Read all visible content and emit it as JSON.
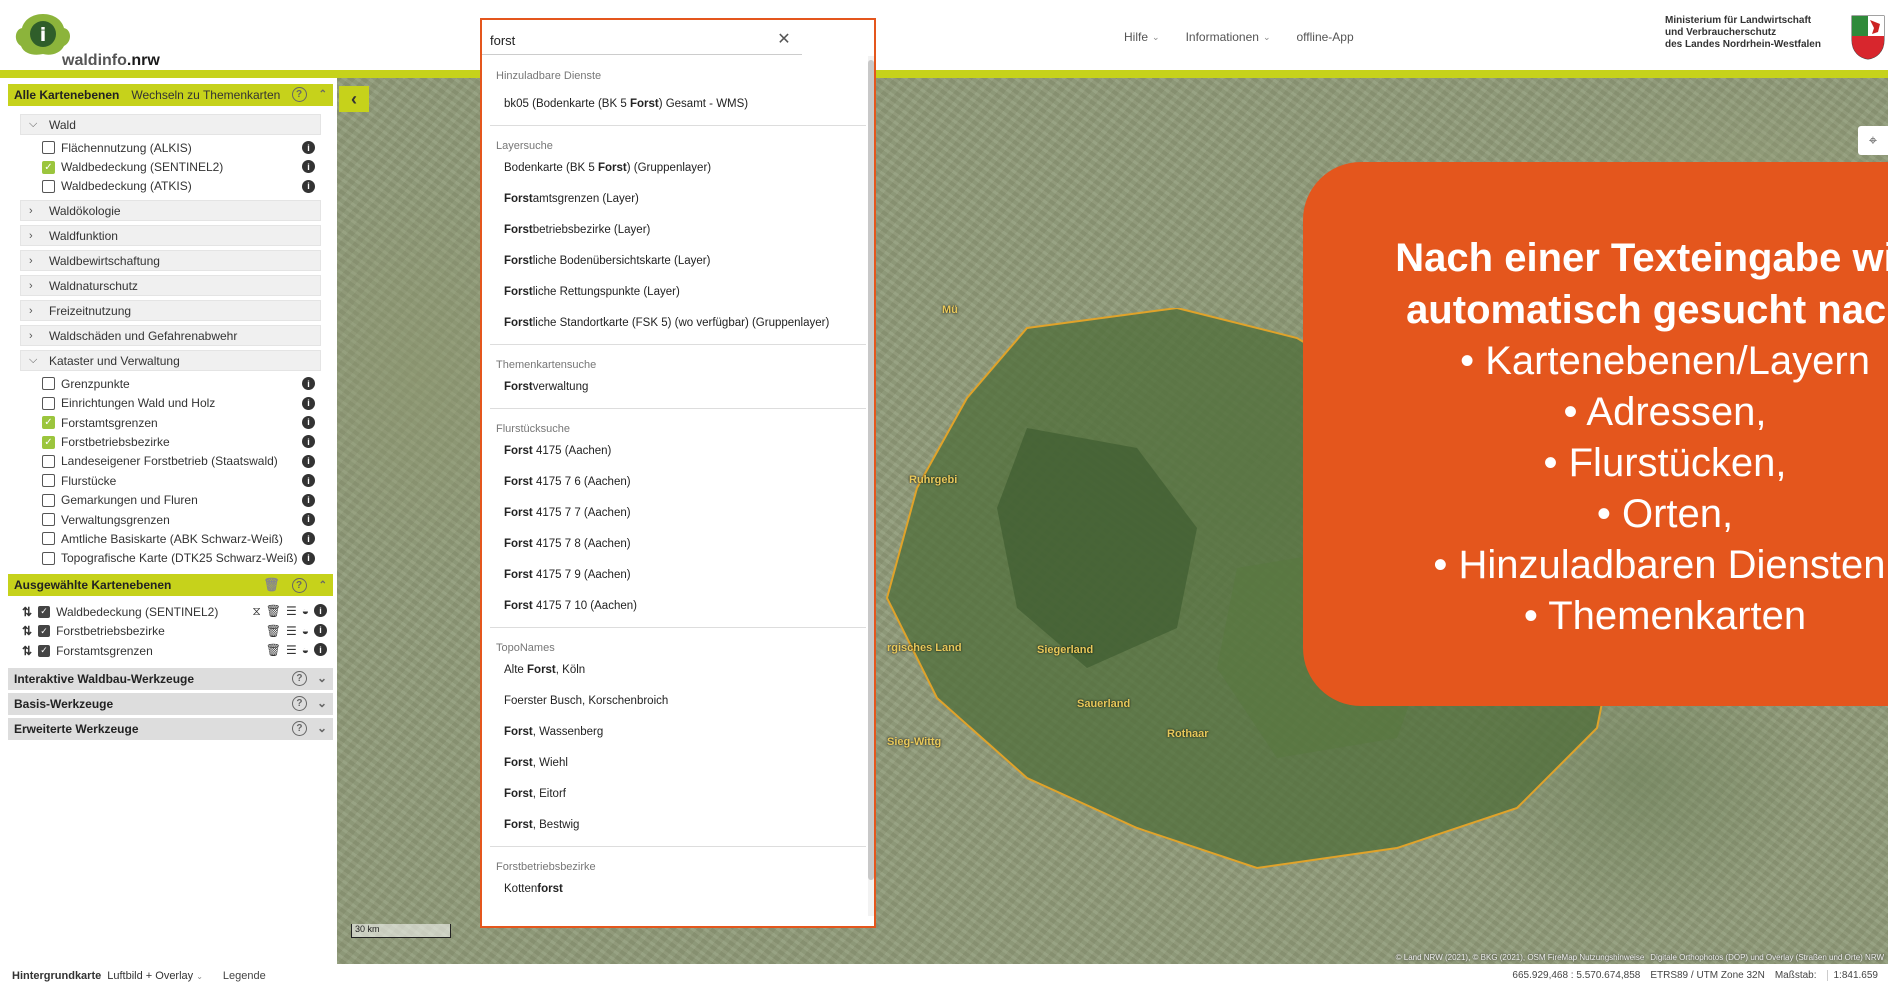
{
  "header": {
    "logo_text_a": "waldinfo",
    "logo_text_b": ".nrw",
    "nav": [
      {
        "label": "Hilfe",
        "has_menu": true
      },
      {
        "label": "Informationen",
        "has_menu": true
      },
      {
        "label": "offline-App",
        "has_menu": false
      }
    ],
    "ministry": [
      "Ministerium für Landwirtschaft",
      "und Verbraucherschutz",
      "des Landes Nordrhein-Westfalen"
    ]
  },
  "sidebar": {
    "layers_header": "Alle Kartenebenen",
    "switch_label": "Wechseln zu Themenkarten",
    "groups": [
      {
        "label": "Wald",
        "expanded": true,
        "layers": [
          {
            "label": "Flächennutzung (ALKIS)",
            "checked": false
          },
          {
            "label": "Waldbedeckung (SENTINEL2)",
            "checked": true
          },
          {
            "label": "Waldbedeckung (ATKIS)",
            "checked": false
          }
        ]
      },
      {
        "label": "Waldökologie",
        "expanded": false
      },
      {
        "label": "Waldfunktion",
        "expanded": false
      },
      {
        "label": "Waldbewirtschaftung",
        "expanded": false
      },
      {
        "label": "Waldnaturschutz",
        "expanded": false
      },
      {
        "label": "Freizeitnutzung",
        "expanded": false
      },
      {
        "label": "Waldschäden und Gefahrenabwehr",
        "expanded": false
      },
      {
        "label": "Kataster und Verwaltung",
        "expanded": true,
        "layers": [
          {
            "label": "Grenzpunkte",
            "checked": false
          },
          {
            "label": "Einrichtungen Wald und Holz",
            "checked": false
          },
          {
            "label": "Forstamtsgrenzen",
            "checked": true
          },
          {
            "label": "Forstbetriebsbezirke",
            "checked": true
          },
          {
            "label": "Landeseigener Forstbetrieb (Staatswald)",
            "checked": false
          },
          {
            "label": "Flurstücke",
            "checked": false
          },
          {
            "label": "Gemarkungen und Fluren",
            "checked": false
          },
          {
            "label": "Verwaltungsgrenzen",
            "checked": false
          },
          {
            "label": "Amtliche Basiskarte (ABK Schwarz-Weiß)",
            "checked": false
          },
          {
            "label": "Topografische Karte (DTK25 Schwarz-Weiß)",
            "checked": false
          }
        ]
      }
    ],
    "selected_header": "Ausgewählte Kartenebenen",
    "selected": [
      {
        "label": "Waldbedeckung (SENTINEL2)"
      },
      {
        "label": "Forstbetriebsbezirke"
      },
      {
        "label": "Forstamtsgrenzen"
      }
    ],
    "tools": [
      {
        "label": "Interaktive Waldbau-Werkzeuge"
      },
      {
        "label": "Basis-Werkzeuge"
      },
      {
        "label": "Erweiterte Werkzeuge"
      }
    ]
  },
  "search": {
    "value": "forst",
    "clear_icon": "close-icon",
    "results": [
      {
        "category": "Hinzuladbare Dienste",
        "items": [
          {
            "pre": "bk05 (Bodenkarte (BK 5 ",
            "match": "Forst",
            "post": ") Gesamt - WMS)"
          }
        ]
      },
      {
        "category": "Layersuche",
        "items": [
          {
            "pre": "Bodenkarte (BK 5 ",
            "match": "Forst",
            "post": ") (Gruppenlayer)"
          },
          {
            "pre": "",
            "match": "Forst",
            "post": "amtsgrenzen (Layer)"
          },
          {
            "pre": "",
            "match": "Forst",
            "post": "betriebsbezirke (Layer)"
          },
          {
            "pre": "",
            "match": "Forst",
            "post": "liche Bodenübersichtskarte (Layer)"
          },
          {
            "pre": "",
            "match": "Forst",
            "post": "liche Rettungspunkte (Layer)"
          },
          {
            "pre": "",
            "match": "Forst",
            "post": "liche Standortkarte (FSK 5) (wo verfügbar) (Gruppenlayer)"
          }
        ]
      },
      {
        "category": "Themenkartensuche",
        "items": [
          {
            "pre": "",
            "match": "Forst",
            "post": "verwaltung"
          }
        ]
      },
      {
        "category": "Flurstücksuche",
        "items": [
          {
            "pre": "",
            "match": "Forst",
            "post": " 4175    (Aachen)"
          },
          {
            "pre": "",
            "match": "Forst",
            "post": " 4175 7 6  (Aachen)"
          },
          {
            "pre": "",
            "match": "Forst",
            "post": " 4175 7 7  (Aachen)"
          },
          {
            "pre": "",
            "match": "Forst",
            "post": " 4175 7 8  (Aachen)"
          },
          {
            "pre": "",
            "match": "Forst",
            "post": " 4175 7 9  (Aachen)"
          },
          {
            "pre": "",
            "match": "Forst",
            "post": " 4175 7 10  (Aachen)"
          }
        ]
      },
      {
        "category": "TopoNames",
        "items": [
          {
            "pre": "Alte ",
            "match": "Forst",
            "post": ", Köln"
          },
          {
            "pre": "Foerster Busch, Korschenbroich",
            "match": "",
            "post": ""
          },
          {
            "pre": "",
            "match": "Forst",
            "post": ", Wassenberg"
          },
          {
            "pre": "",
            "match": "Forst",
            "post": ", Wiehl"
          },
          {
            "pre": "",
            "match": "Forst",
            "post": ", Eitorf"
          },
          {
            "pre": "",
            "match": "Forst",
            "post": ", Bestwig"
          }
        ]
      },
      {
        "category": "Forstbetriebsbezirke",
        "items": [
          {
            "pre": "Kotten",
            "match": "forst",
            "post": ""
          }
        ]
      }
    ]
  },
  "callout": {
    "heading_line1": "Nach einer Texteingabe wird",
    "heading_line2": "automatisch gesucht nach:",
    "bullets": [
      "Kartenebenen/Layern",
      "Adressen,",
      "Flurstücken,",
      "Orten,",
      "Hinzuladbaren Diensten,",
      " Themenkarten"
    ]
  },
  "map": {
    "scale_label": "30 km",
    "labels": [
      "Mü",
      "Ruhrgebi",
      "rgisches Land",
      "Siegerland",
      "Sieg-Wittg",
      "Sauerland",
      "Rothaar"
    ],
    "attribution": [
      "© Land NRW (2021), © BKG (2021), OSM FireMap Nutzungshinweise",
      "Digitale Orthophotos (DOP) und Overlay (Straßen und Orte) NRW"
    ],
    "colors": {
      "accent": "#c6d21b",
      "callout": "#e4561d",
      "forest_border": "#e0a32a"
    }
  },
  "toolbar_right": [
    "compass-icon",
    "fullscreen-icon",
    "calendar-icon",
    "nrw-map-icon",
    "zoom-in-icon",
    "zoom-out-icon",
    "layers-globe-icon",
    "locate-icon"
  ],
  "bottombar": {
    "bg_label": "Hintergrundkarte",
    "bg_value": "Luftbild + Overlay",
    "legend": "Legende",
    "coords": "665.929,468 : 5.570.674,858",
    "crs": "ETRS89 / UTM Zone 32N",
    "scale_label": "Maßstab:",
    "scale_value": "1:841.659"
  }
}
